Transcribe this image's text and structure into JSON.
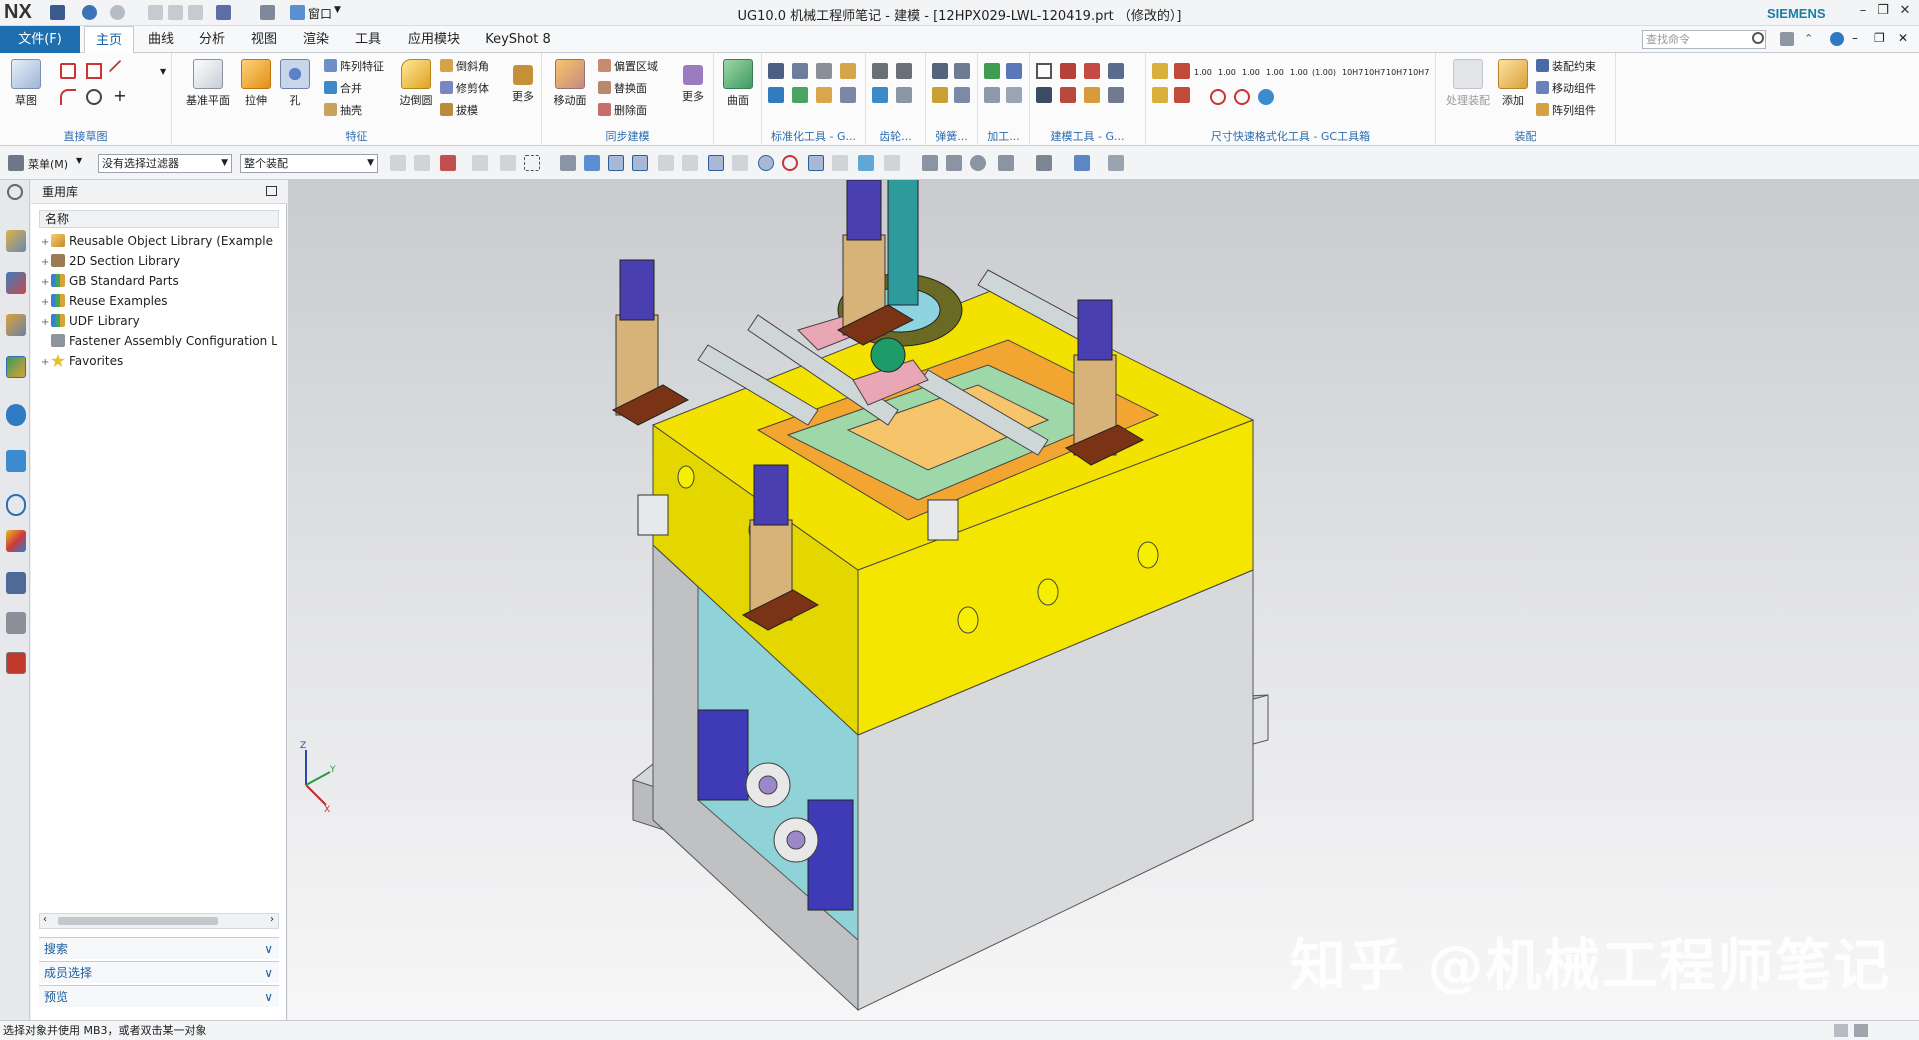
{
  "app": {
    "logo": "NX",
    "title": "UG10.0 机械工程师笔记 - 建模 - [12HPX029-LWL-120419.prt （修改的）]",
    "brand": "SIEMENS",
    "window_menu": "窗口"
  },
  "tabs": {
    "file": "文件(F)",
    "items": [
      "主页",
      "曲线",
      "分析",
      "视图",
      "渲染",
      "工具",
      "应用模块",
      "KeyShot 8"
    ],
    "active": "主页",
    "search_placeholder": "查找命令"
  },
  "ribbon": {
    "sketch": {
      "label": "直接草图",
      "sketch_btn": "草图"
    },
    "feature": {
      "label": "特征",
      "datum": "基准平面",
      "extrude": "拉伸",
      "hole": "孔",
      "pattern": "阵列特征",
      "unite": "合并",
      "shell": "抽壳",
      "edge_blend": "边倒圆",
      "chamfer": "倒斜角",
      "trim_body": "修剪体",
      "draft": "拔模",
      "more": "更多"
    },
    "sync": {
      "label": "同步建模",
      "move_face": "移动面",
      "offset_region": "偏置区域",
      "replace_face": "替换面",
      "delete_face": "删除面",
      "more": "更多"
    },
    "surface": {
      "label": "",
      "surface_btn": "曲面"
    },
    "std_tools": {
      "label": "标准化工具 - G..."
    },
    "gear": {
      "label": "齿轮..."
    },
    "spring": {
      "label": "弹簧..."
    },
    "machining": {
      "label": "加工..."
    },
    "build_tools": {
      "label": "建模工具 - G..."
    },
    "dim_tools": {
      "label": "尺寸快速格式化工具 - GC工具箱",
      "values": [
        "1.00",
        "1.00",
        "1.00",
        "1.00",
        "1.00",
        "(1.00)",
        "10H7",
        "10H7",
        "10H7",
        "10H7"
      ]
    },
    "assembly": {
      "label": "装配",
      "process": "处理装配",
      "add": "添加",
      "constraint": "装配约束",
      "move": "移动组件",
      "pattern": "阵列组件"
    }
  },
  "toolbar2": {
    "menu": "菜单(M)",
    "filter": "没有选择过滤器",
    "scope": "整个装配"
  },
  "navigator": {
    "title": "重用库",
    "column": "名称",
    "items": [
      {
        "label": "Reusable Object Library (Example",
        "expandable": true,
        "icon": "library-icon"
      },
      {
        "label": "2D Section Library",
        "expandable": true,
        "icon": "section-library-icon"
      },
      {
        "label": "GB Standard Parts",
        "expandable": true,
        "icon": "standard-parts-icon"
      },
      {
        "label": "Reuse Examples",
        "expandable": true,
        "icon": "books-icon"
      },
      {
        "label": "UDF Library",
        "expandable": true,
        "icon": "books-icon"
      },
      {
        "label": "Fastener Assembly Configuration L",
        "expandable": false,
        "icon": "fastener-icon"
      },
      {
        "label": "Favorites",
        "expandable": true,
        "icon": "star-icon"
      }
    ],
    "sections": [
      "搜索",
      "成员选择",
      "预览"
    ]
  },
  "viewport": {
    "triad": {
      "x": "X",
      "y": "Y",
      "z": "Z"
    },
    "watermark": "知乎 @机械工程师笔记"
  },
  "status": {
    "message": "选择对象并使用 MB3，或者双击某一对象"
  },
  "colors": {
    "file_tab": "#1f6fb0",
    "plate_yellow": "#f5e600",
    "plate_grey": "#bfc1c3",
    "slider_orange": "#f2a531",
    "pillar_blue": "#4a3fb0",
    "bushing_tan": "#d7b37a"
  }
}
